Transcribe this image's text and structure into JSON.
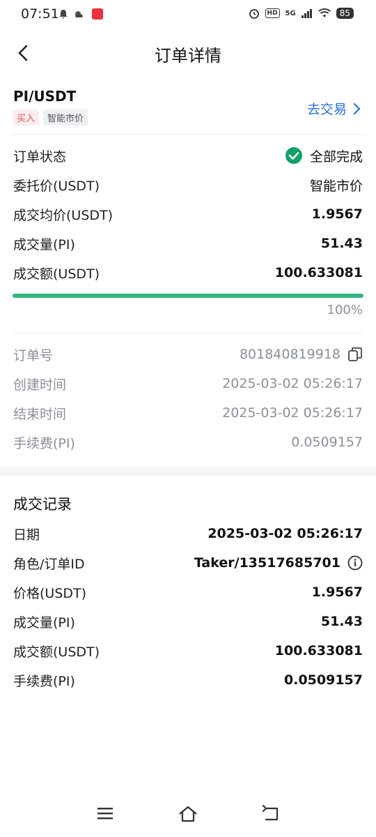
{
  "status_bar": {
    "time": "07:51",
    "hd": "HD",
    "net": "5G",
    "battery": "85"
  },
  "header": {
    "title": "订单详情"
  },
  "order": {
    "pair": "PI/USDT",
    "side_tag": "买入",
    "type_tag": "智能市价",
    "trade_link": "去交易"
  },
  "summary": [
    {
      "label": "订单状态",
      "value": "全部完成"
    },
    {
      "label": "委托价(USDT)",
      "value": "智能市价"
    },
    {
      "label": "成交均价(USDT)",
      "value": "1.9567"
    },
    {
      "label": "成交量(PI)",
      "value": "51.43"
    },
    {
      "label": "成交额(USDT)",
      "value": "100.633081"
    }
  ],
  "progress": {
    "fraction": 1.0,
    "label": "100%"
  },
  "details": [
    {
      "label": "订单号",
      "value": "801840819918"
    },
    {
      "label": "创建时间",
      "value": "2025-03-02 05:26:17"
    },
    {
      "label": "结束时间",
      "value": "2025-03-02 05:26:17"
    },
    {
      "label": "手续费(PI)",
      "value": "0.0509157"
    }
  ],
  "trades": {
    "title": "成交记录",
    "rows": [
      {
        "label": "日期",
        "value": "2025-03-02 05:26:17"
      },
      {
        "label": "角色/订单ID",
        "value": "Taker/13517685701"
      },
      {
        "label": "价格(USDT)",
        "value": "1.9567"
      },
      {
        "label": "成交量(PI)",
        "value": "51.43"
      },
      {
        "label": "成交额(USDT)",
        "value": "100.633081"
      },
      {
        "label": "手续费(PI)",
        "value": "0.0509157"
      }
    ]
  },
  "colors": {
    "accent": "#2a6fdb",
    "success": "#2db87d",
    "buy": "#e8505b"
  }
}
